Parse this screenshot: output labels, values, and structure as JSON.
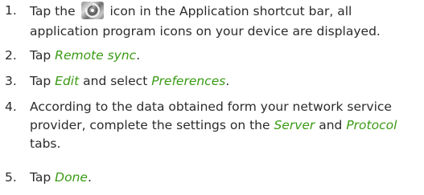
{
  "steps": [
    {
      "number": "1.",
      "lines": [
        {
          "before": "Tap the",
          "icon": "applications-icon",
          "after": "icon in the Application shortcut bar, all"
        },
        {
          "text": "application program icons on your device are displayed."
        }
      ]
    },
    {
      "number": "2.",
      "text_before": "Tap ",
      "link": "Remote sync",
      "text_after": "."
    },
    {
      "number": "3.",
      "text_before": "Tap ",
      "link": "Edit",
      "text_middle": " and select ",
      "link2": "Preferences",
      "text_after": "."
    },
    {
      "number": "4.",
      "line1": "According to the data obtained form your network service",
      "line2_before": "provider, complete the settings on the ",
      "line2_link1": "Server",
      "line2_middle": " and ",
      "line2_link2": "Protocol",
      "line3": "tabs."
    },
    {
      "number": "5.",
      "text_before": "Tap ",
      "link": "Done",
      "text_after": "."
    }
  ],
  "colors": {
    "highlight": "#3a9a14",
    "text": "#2b2b2b"
  }
}
